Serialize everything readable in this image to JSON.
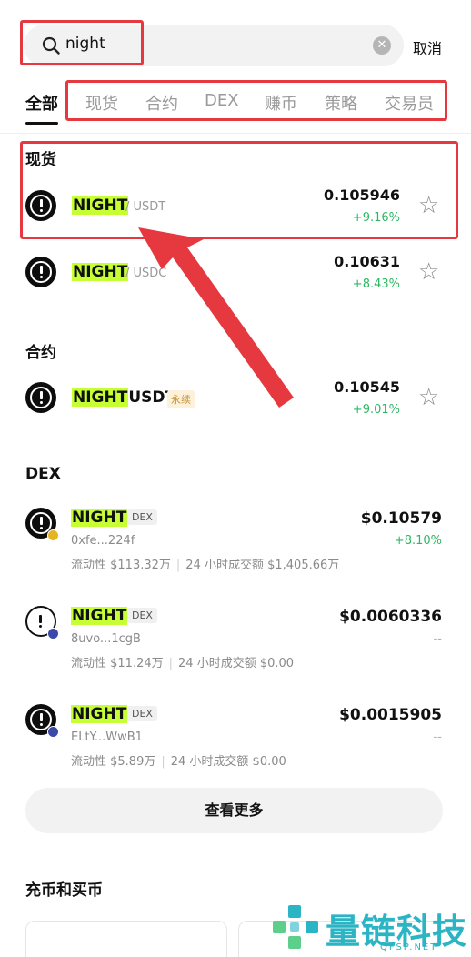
{
  "search": {
    "value": "night",
    "cancel_label": "取消"
  },
  "tabs": [
    {
      "label": "全部",
      "active": true
    },
    {
      "label": "现货"
    },
    {
      "label": "合约"
    },
    {
      "label": "DEX"
    },
    {
      "label": "赚币"
    },
    {
      "label": "策略"
    },
    {
      "label": "交易员"
    }
  ],
  "spot": {
    "title": "现货",
    "rows": [
      {
        "symbol": "NIGHT",
        "pair": "/ USDT",
        "price": "0.105946",
        "change": "+9.16%"
      },
      {
        "symbol": "NIGHT",
        "pair": "/ USDC",
        "price": "0.10631",
        "change": "+8.43%"
      }
    ]
  },
  "futures": {
    "title": "合约",
    "rows": [
      {
        "symbol": "NIGHT",
        "suffix": "USDT",
        "badge": "永续",
        "price": "0.10545",
        "change": "+9.01%"
      }
    ]
  },
  "dex": {
    "title": "DEX",
    "rows": [
      {
        "symbol": "NIGHT",
        "badge": "DEX",
        "address": "0xfe...224f",
        "liquidity": "流动性 $113.32万",
        "volume": "24 小时成交额 $1,405.66万",
        "price": "$0.10579",
        "change": "+8.10%"
      },
      {
        "symbol": "NIGHT",
        "badge": "DEX",
        "address": "8uvo...1cgB",
        "liquidity": "流动性 $11.24万",
        "volume": "24 小时成交额 $0.00",
        "price": "$0.0060336",
        "change": "--"
      },
      {
        "symbol": "NIGHT",
        "badge": "DEX",
        "address": "ELtY...WwB1",
        "liquidity": "流动性 $5.89万",
        "volume": "24 小时成交额 $0.00",
        "price": "$0.0015905",
        "change": "--"
      }
    ]
  },
  "more_label": "查看更多",
  "deposit_section": {
    "title": "充币和买币"
  },
  "watermark": {
    "text": "量链科技",
    "sub": "QFSP.NET"
  },
  "colors": {
    "highlight": "#c6ff33",
    "positive": "#2fb863",
    "annotation": "#e5393f",
    "watermark": "#2bb4c4"
  }
}
